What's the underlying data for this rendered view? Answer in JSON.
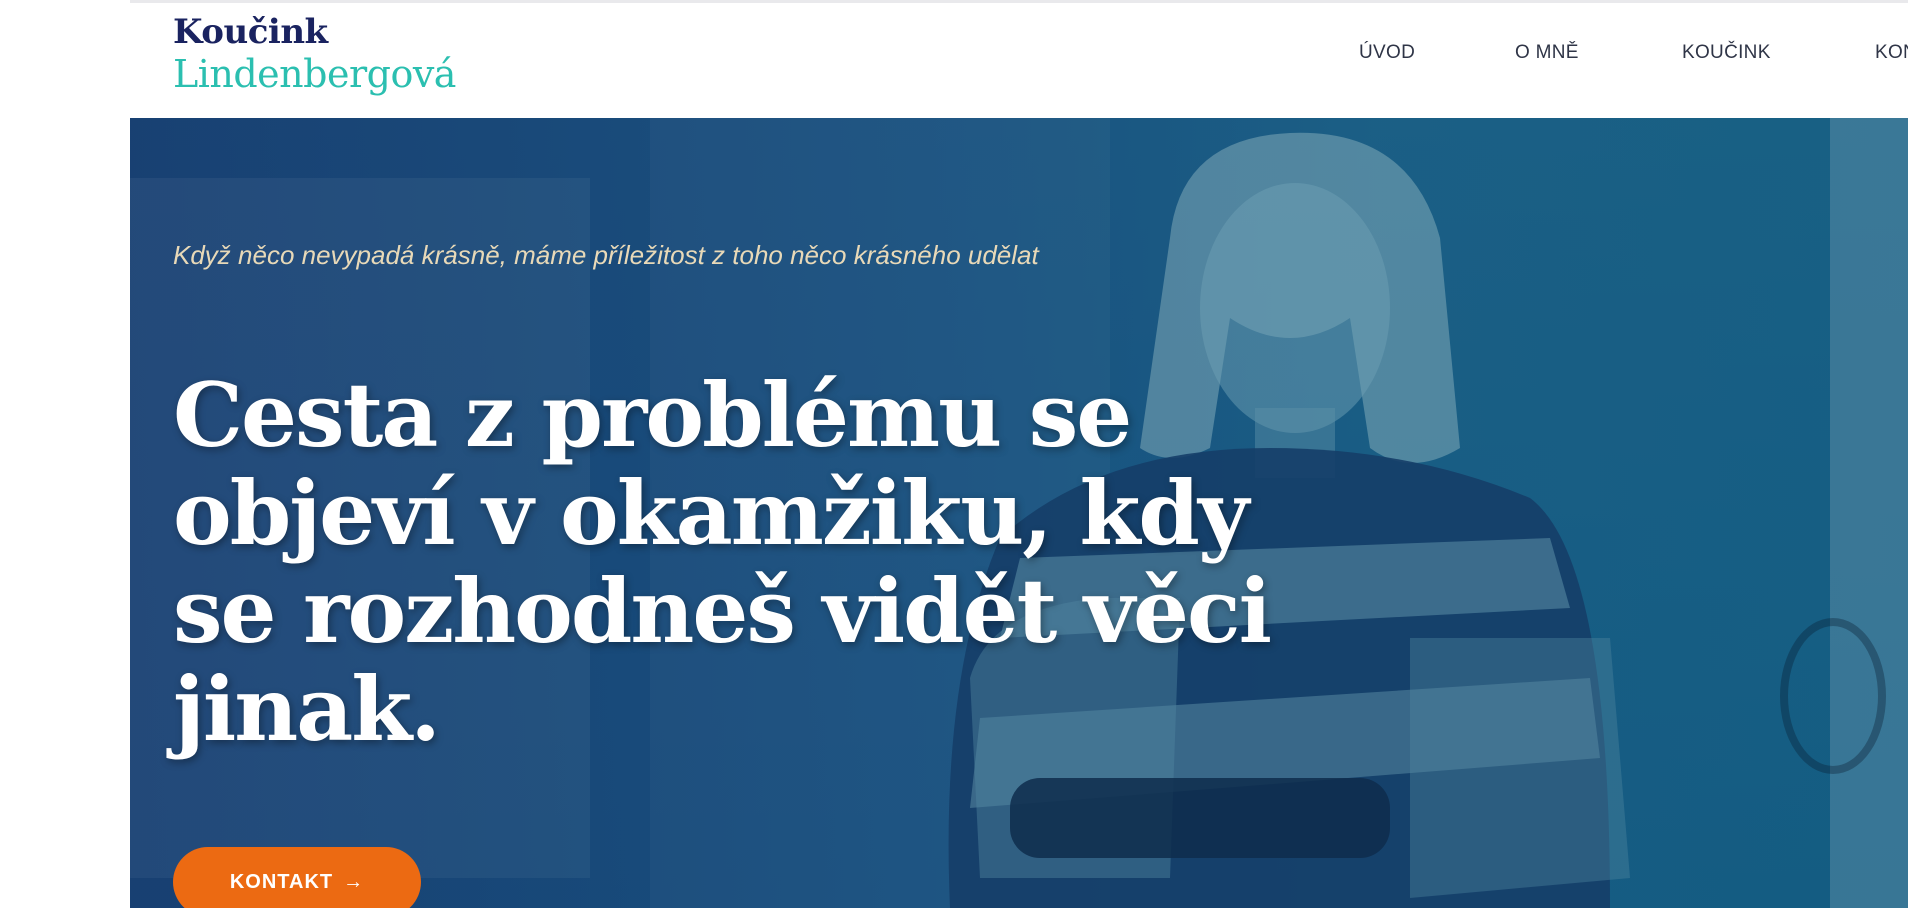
{
  "logo": {
    "line1": "Koučink",
    "line2": "Lindenbergová"
  },
  "nav": {
    "items": [
      {
        "label": "ÚVOD"
      },
      {
        "label": "O MNĚ"
      },
      {
        "label": "KOUČINK"
      },
      {
        "label": "KON"
      }
    ]
  },
  "hero": {
    "tagline": "Když něco nevypadá krásně, máme příležitost z toho něco krásného udělat",
    "headline": "Cesta z problému se objeví v okamžiku, kdy se rozhodneš vidět věci jinak.",
    "cta_label": "KONTAKT",
    "cta_arrow": "→"
  },
  "colors": {
    "brand_navy": "#1a2360",
    "brand_teal": "#2bbfb0",
    "cta_orange": "#ec6a12",
    "hero_overlay": "#1d4f86",
    "tagline": "#e8d9b8"
  }
}
